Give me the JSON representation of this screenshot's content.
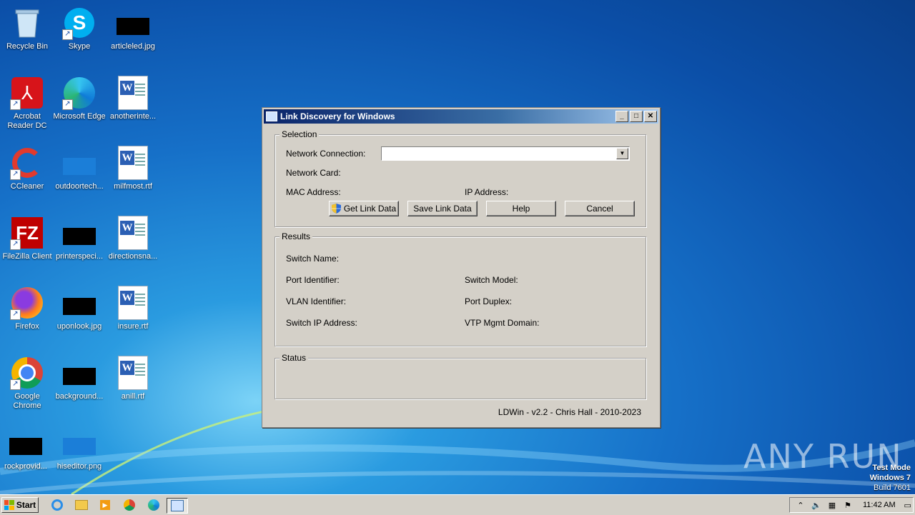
{
  "desktop": {
    "icons": [
      {
        "label": "Recycle Bin"
      },
      {
        "label": "Skype"
      },
      {
        "label": "articleled.jpg"
      },
      {
        "label": "Acrobat Reader DC"
      },
      {
        "label": "Microsoft Edge"
      },
      {
        "label": "anotherinte..."
      },
      {
        "label": "CCleaner"
      },
      {
        "label": "outdoortech..."
      },
      {
        "label": "milfmost.rtf"
      },
      {
        "label": "FileZilla Client"
      },
      {
        "label": "printerspeci..."
      },
      {
        "label": "directionsna..."
      },
      {
        "label": "Firefox"
      },
      {
        "label": "uponlook.jpg"
      },
      {
        "label": "insure.rtf"
      },
      {
        "label": "Google Chrome"
      },
      {
        "label": "background..."
      },
      {
        "label": "anill.rtf"
      },
      {
        "label": "rockprovid..."
      },
      {
        "label": "hiseditor.png"
      }
    ]
  },
  "window": {
    "title": "Link Discovery for Windows",
    "selection": {
      "title": "Selection",
      "network_connection_label": "Network Connection:",
      "network_connection_value": "",
      "network_card_label": "Network Card:",
      "mac_address_label": "MAC Address:",
      "ip_address_label": "IP Address:"
    },
    "buttons": {
      "get_link_data": "Get Link Data",
      "save_link_data": "Save Link Data",
      "help": "Help",
      "cancel": "Cancel"
    },
    "results": {
      "title": "Results",
      "switch_name": "Switch Name:",
      "port_identifier": "Port Identifier:",
      "switch_model": "Switch Model:",
      "vlan_identifier": "VLAN Identifier:",
      "port_duplex": "Port Duplex:",
      "switch_ip": "Switch IP Address:",
      "vtp_domain": "VTP Mgmt Domain:"
    },
    "status": {
      "title": "Status"
    },
    "footer": "LDWin - v2.2 - Chris Hall - 2010-2023"
  },
  "watermark": "ANY RUN",
  "test_mode": {
    "line1": "Test Mode",
    "line2": "Windows 7",
    "line3": "Build 7601"
  },
  "taskbar": {
    "start_label": "Start",
    "clock": "11:42 AM"
  }
}
